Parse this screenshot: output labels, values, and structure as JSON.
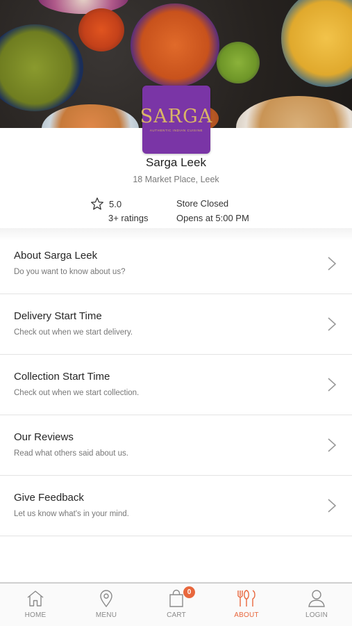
{
  "store": {
    "name": "Sarga Leek",
    "address": "18 Market Place, Leek",
    "rating": "5.0",
    "rating_count": "3+ ratings",
    "status": "Store Closed",
    "opens_at": "Opens at 5:00 PM"
  },
  "logo": {
    "word": "SARGA",
    "tagline": "AUTHENTIC INDIAN CUISINE",
    "background": "#7a35a6",
    "text_color": "#d9b566"
  },
  "menu": [
    {
      "title": "About Sarga Leek",
      "subtitle": "Do you want to know about us?"
    },
    {
      "title": "Delivery Start Time",
      "subtitle": "Check out when we start delivery."
    },
    {
      "title": "Collection Start Time",
      "subtitle": "Check out when we start collection."
    },
    {
      "title": "Our Reviews",
      "subtitle": "Read what others said about us."
    },
    {
      "title": "Give Feedback",
      "subtitle": "Let us know what's in your mind."
    }
  ],
  "tabs": {
    "home": {
      "label": "HOME",
      "icon": "home-icon"
    },
    "menu": {
      "label": "MENU",
      "icon": "location-pin-icon"
    },
    "cart": {
      "label": "CART",
      "icon": "shopping-bag-icon",
      "badge": "0"
    },
    "about": {
      "label": "ABOUT",
      "icon": "fork-knife-icon",
      "active": true
    },
    "login": {
      "label": "LOGIN",
      "icon": "user-icon"
    }
  },
  "colors": {
    "accent": "#e8673d",
    "brand_purple": "#7a35a6",
    "inactive_tab": "#8a8a8a"
  }
}
